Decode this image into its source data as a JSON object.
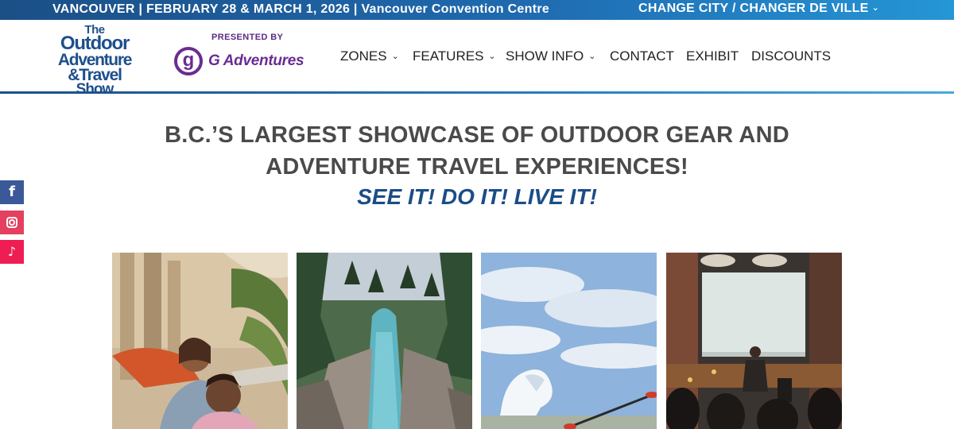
{
  "topbar": {
    "event_text": "VANCOUVER | FEBRUARY 28 & MARCH 1, 2026 | Vancouver Convention Centre",
    "change_city": "CHANGE CITY / CHANGER DE VILLE",
    "chevron_icon": "chevron-down-icon",
    "gradient_colors": [
      "#1b4f86",
      "#2596d6"
    ]
  },
  "logo": {
    "line1": "The",
    "line2": "Outdoor",
    "line3": "Adventure",
    "line4": "&Travel",
    "line5": "Show"
  },
  "sponsor": {
    "presented_by": "PRESENTED BY",
    "mark": "g",
    "name": "G Adventures",
    "color": "#6a2c91"
  },
  "nav": {
    "items": [
      {
        "label": "ZONES",
        "dropdown": true
      },
      {
        "label": "FEATURES",
        "dropdown": true
      },
      {
        "label": "SHOW INFO",
        "dropdown": true
      },
      {
        "label": "CONTACT",
        "dropdown": false
      },
      {
        "label": "EXHIBIT",
        "dropdown": false
      },
      {
        "label": "DISCOUNTS",
        "dropdown": false
      }
    ]
  },
  "social": {
    "facebook": {
      "glyph": "f",
      "icon": "facebook-icon",
      "color": "#3b5998"
    },
    "instagram": {
      "icon": "instagram-icon",
      "color": "#e4405f"
    },
    "tiktok": {
      "glyph": "♪",
      "icon": "tiktok-icon",
      "color": "#ee1d52"
    }
  },
  "hero": {
    "headline_line1": "B.C.’S LARGEST SHOWCASE OF OUTDOOR GEAR AND",
    "headline_line2": "ADVENTURE TRAVEL EXPERIENCES!",
    "tagline": "SEE IT! DO IT! LIVE IT!",
    "tagline_color": "#1b4d87"
  },
  "tiles": [
    {
      "subject": "couple-in-barcelona"
    },
    {
      "subject": "canyon-river"
    },
    {
      "subject": "kayaker-and-iceberg"
    },
    {
      "subject": "speaker-presentation"
    }
  ]
}
